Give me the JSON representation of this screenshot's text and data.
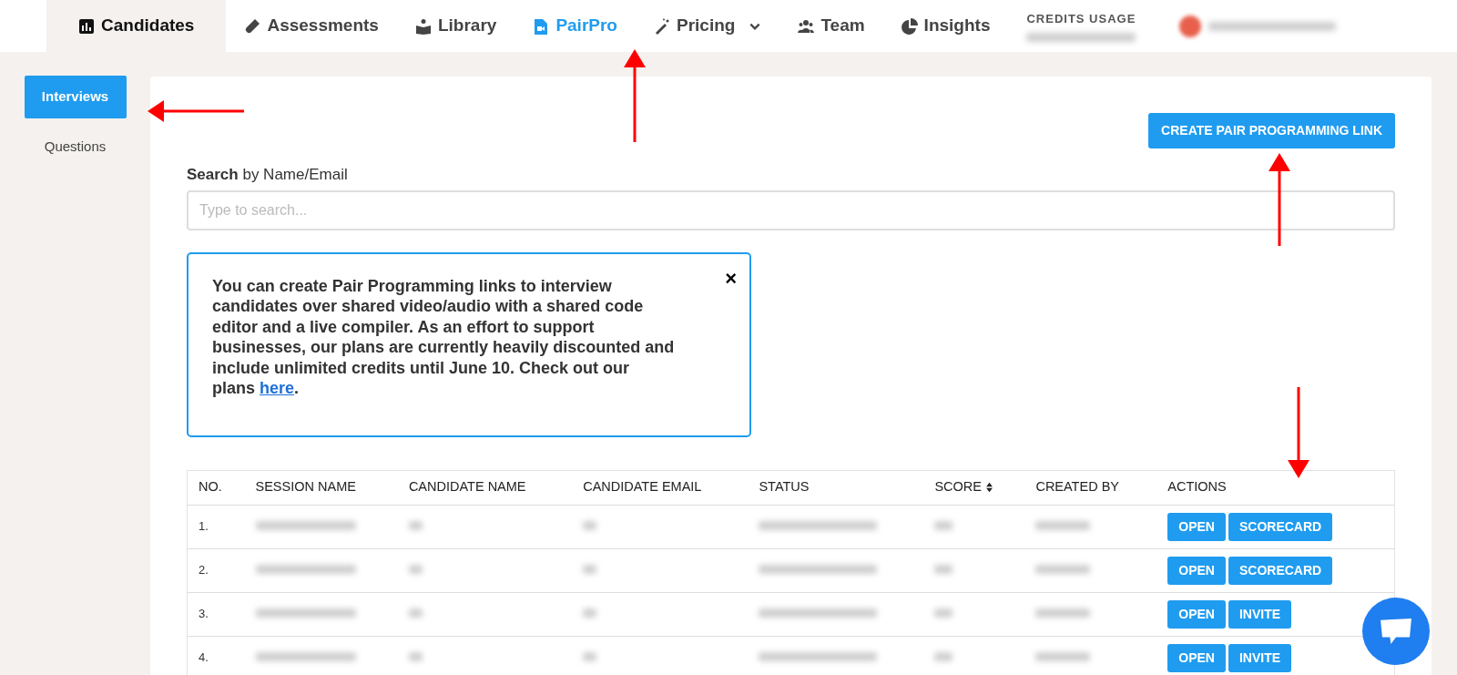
{
  "nav": {
    "items": [
      {
        "label": "Candidates",
        "selected": true
      },
      {
        "label": "Assessments",
        "selected": false
      },
      {
        "label": "Library",
        "selected": false
      },
      {
        "label": "PairPro",
        "selected": false,
        "current": true
      },
      {
        "label": "Pricing",
        "selected": false,
        "dropdown": true
      },
      {
        "label": "Team",
        "selected": false
      },
      {
        "label": "Insights",
        "selected": false
      }
    ],
    "credits_label": "CREDITS USAGE"
  },
  "sidebar": {
    "items": [
      {
        "label": "Interviews",
        "selected": true
      },
      {
        "label": "Questions",
        "selected": false
      }
    ]
  },
  "create_button": "CREATE PAIR PROGRAMMING LINK",
  "search": {
    "label_bold": "Search",
    "label_rest": "by Name/Email",
    "placeholder": "Type to search..."
  },
  "notice": {
    "text": "You can create Pair Programming links to interview candidates over shared video/audio with a shared code editor and a live compiler. As an effort to support businesses, our plans are currently heavily discounted and include unlimited credits until June 10. Check out our plans ",
    "link": "here",
    "end": ".",
    "close": "×"
  },
  "table": {
    "columns": [
      {
        "label": "NO."
      },
      {
        "label": "SESSION NAME"
      },
      {
        "label": "CANDIDATE NAME"
      },
      {
        "label": "CANDIDATE EMAIL"
      },
      {
        "label": "STATUS"
      },
      {
        "label": "SCORE",
        "sortable": true
      },
      {
        "label": "CREATED BY"
      },
      {
        "label": "ACTIONS"
      }
    ],
    "rows": [
      {
        "no": "1.",
        "actions": [
          "OPEN",
          "SCORECARD"
        ]
      },
      {
        "no": "2.",
        "actions": [
          "OPEN",
          "SCORECARD"
        ]
      },
      {
        "no": "3.",
        "actions": [
          "OPEN",
          "INVITE"
        ]
      },
      {
        "no": "4.",
        "actions": [
          "OPEN",
          "INVITE"
        ]
      }
    ]
  }
}
